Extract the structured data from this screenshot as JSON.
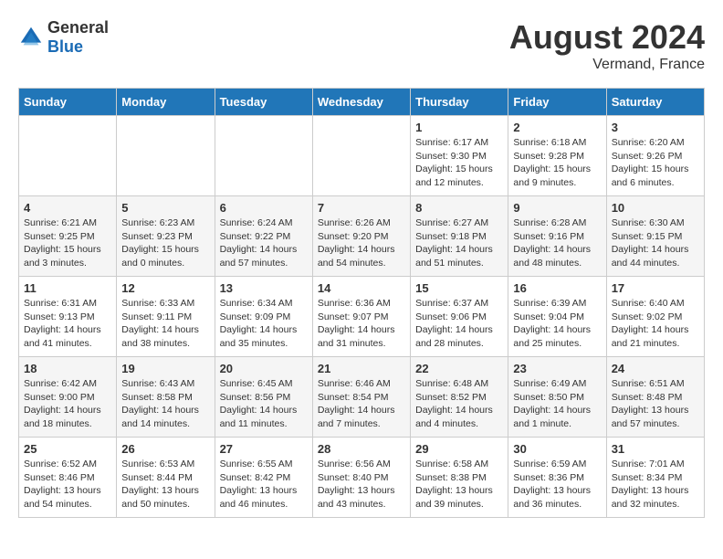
{
  "header": {
    "logo": {
      "general": "General",
      "blue": "Blue"
    },
    "title": "August 2024",
    "subtitle": "Vermand, France"
  },
  "days_of_week": [
    "Sunday",
    "Monday",
    "Tuesday",
    "Wednesday",
    "Thursday",
    "Friday",
    "Saturday"
  ],
  "weeks": [
    [
      {
        "day": "",
        "info": ""
      },
      {
        "day": "",
        "info": ""
      },
      {
        "day": "",
        "info": ""
      },
      {
        "day": "",
        "info": ""
      },
      {
        "day": "1",
        "info": "Sunrise: 6:17 AM\nSunset: 9:30 PM\nDaylight: 15 hours\nand 12 minutes."
      },
      {
        "day": "2",
        "info": "Sunrise: 6:18 AM\nSunset: 9:28 PM\nDaylight: 15 hours\nand 9 minutes."
      },
      {
        "day": "3",
        "info": "Sunrise: 6:20 AM\nSunset: 9:26 PM\nDaylight: 15 hours\nand 6 minutes."
      }
    ],
    [
      {
        "day": "4",
        "info": "Sunrise: 6:21 AM\nSunset: 9:25 PM\nDaylight: 15 hours\nand 3 minutes."
      },
      {
        "day": "5",
        "info": "Sunrise: 6:23 AM\nSunset: 9:23 PM\nDaylight: 15 hours\nand 0 minutes."
      },
      {
        "day": "6",
        "info": "Sunrise: 6:24 AM\nSunset: 9:22 PM\nDaylight: 14 hours\nand 57 minutes."
      },
      {
        "day": "7",
        "info": "Sunrise: 6:26 AM\nSunset: 9:20 PM\nDaylight: 14 hours\nand 54 minutes."
      },
      {
        "day": "8",
        "info": "Sunrise: 6:27 AM\nSunset: 9:18 PM\nDaylight: 14 hours\nand 51 minutes."
      },
      {
        "day": "9",
        "info": "Sunrise: 6:28 AM\nSunset: 9:16 PM\nDaylight: 14 hours\nand 48 minutes."
      },
      {
        "day": "10",
        "info": "Sunrise: 6:30 AM\nSunset: 9:15 PM\nDaylight: 14 hours\nand 44 minutes."
      }
    ],
    [
      {
        "day": "11",
        "info": "Sunrise: 6:31 AM\nSunset: 9:13 PM\nDaylight: 14 hours\nand 41 minutes."
      },
      {
        "day": "12",
        "info": "Sunrise: 6:33 AM\nSunset: 9:11 PM\nDaylight: 14 hours\nand 38 minutes."
      },
      {
        "day": "13",
        "info": "Sunrise: 6:34 AM\nSunset: 9:09 PM\nDaylight: 14 hours\nand 35 minutes."
      },
      {
        "day": "14",
        "info": "Sunrise: 6:36 AM\nSunset: 9:07 PM\nDaylight: 14 hours\nand 31 minutes."
      },
      {
        "day": "15",
        "info": "Sunrise: 6:37 AM\nSunset: 9:06 PM\nDaylight: 14 hours\nand 28 minutes."
      },
      {
        "day": "16",
        "info": "Sunrise: 6:39 AM\nSunset: 9:04 PM\nDaylight: 14 hours\nand 25 minutes."
      },
      {
        "day": "17",
        "info": "Sunrise: 6:40 AM\nSunset: 9:02 PM\nDaylight: 14 hours\nand 21 minutes."
      }
    ],
    [
      {
        "day": "18",
        "info": "Sunrise: 6:42 AM\nSunset: 9:00 PM\nDaylight: 14 hours\nand 18 minutes."
      },
      {
        "day": "19",
        "info": "Sunrise: 6:43 AM\nSunset: 8:58 PM\nDaylight: 14 hours\nand 14 minutes."
      },
      {
        "day": "20",
        "info": "Sunrise: 6:45 AM\nSunset: 8:56 PM\nDaylight: 14 hours\nand 11 minutes."
      },
      {
        "day": "21",
        "info": "Sunrise: 6:46 AM\nSunset: 8:54 PM\nDaylight: 14 hours\nand 7 minutes."
      },
      {
        "day": "22",
        "info": "Sunrise: 6:48 AM\nSunset: 8:52 PM\nDaylight: 14 hours\nand 4 minutes."
      },
      {
        "day": "23",
        "info": "Sunrise: 6:49 AM\nSunset: 8:50 PM\nDaylight: 14 hours\nand 1 minute."
      },
      {
        "day": "24",
        "info": "Sunrise: 6:51 AM\nSunset: 8:48 PM\nDaylight: 13 hours\nand 57 minutes."
      }
    ],
    [
      {
        "day": "25",
        "info": "Sunrise: 6:52 AM\nSunset: 8:46 PM\nDaylight: 13 hours\nand 54 minutes."
      },
      {
        "day": "26",
        "info": "Sunrise: 6:53 AM\nSunset: 8:44 PM\nDaylight: 13 hours\nand 50 minutes."
      },
      {
        "day": "27",
        "info": "Sunrise: 6:55 AM\nSunset: 8:42 PM\nDaylight: 13 hours\nand 46 minutes."
      },
      {
        "day": "28",
        "info": "Sunrise: 6:56 AM\nSunset: 8:40 PM\nDaylight: 13 hours\nand 43 minutes."
      },
      {
        "day": "29",
        "info": "Sunrise: 6:58 AM\nSunset: 8:38 PM\nDaylight: 13 hours\nand 39 minutes."
      },
      {
        "day": "30",
        "info": "Sunrise: 6:59 AM\nSunset: 8:36 PM\nDaylight: 13 hours\nand 36 minutes."
      },
      {
        "day": "31",
        "info": "Sunrise: 7:01 AM\nSunset: 8:34 PM\nDaylight: 13 hours\nand 32 minutes."
      }
    ]
  ]
}
